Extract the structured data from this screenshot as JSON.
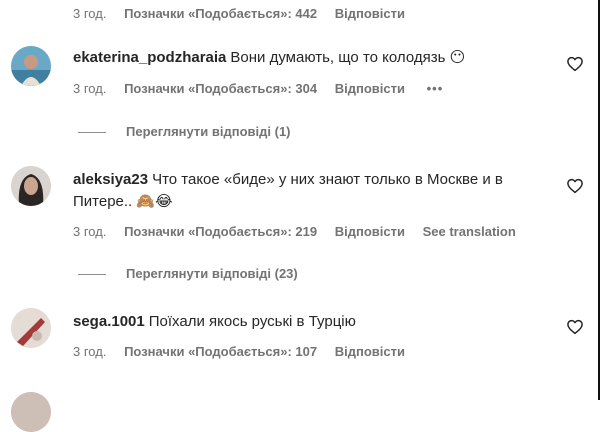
{
  "meta_labels": {
    "likes_prefix": "Позначки «Подобається»:",
    "reply": "Відповісти",
    "translate": "See translation"
  },
  "top_meta": {
    "time": "3 год.",
    "likes": "Позначки «Подобається»: 442",
    "reply": "Відповісти"
  },
  "comments": [
    {
      "username": "ekaterina_podzharaia",
      "text": "Вони думають, що то колодязь 😶",
      "time": "3 год.",
      "likes": "Позначки «Подобається»: 304",
      "reply": "Відповісти",
      "more": "•••",
      "view_replies": "Переглянути відповіді (1)"
    },
    {
      "username": "aleksiya23",
      "text": "Что такое «биде» у них знают только в Москве и в Питере.. 🙈😂",
      "time": "3 год.",
      "likes": "Позначки «Подобається»: 219",
      "reply": "Відповісти",
      "translate": "See translation",
      "view_replies": "Переглянути відповіді (23)"
    },
    {
      "username": "sega.1001",
      "text": "Поїхали якось руські в Турцію",
      "time": "3 год.",
      "likes": "Позначки «Подобається»: 107",
      "reply": "Відповісти"
    }
  ],
  "colors": {
    "text": "#262626",
    "secondary": "#737373",
    "background": "#ffffff"
  },
  "icons": {
    "like": "heart-outline-icon",
    "more": "more-options-icon"
  }
}
